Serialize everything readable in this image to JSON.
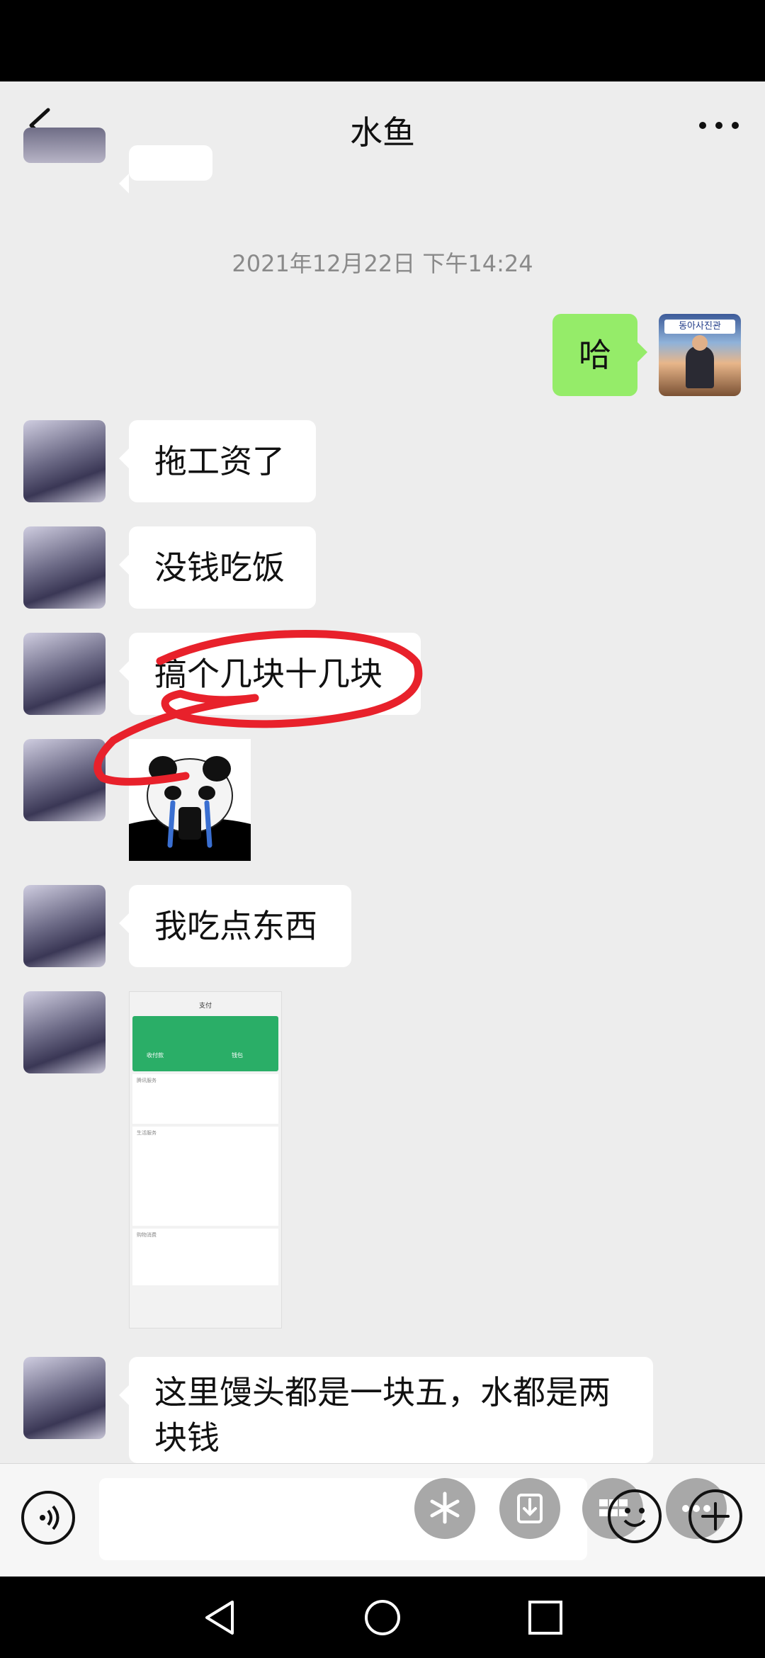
{
  "header": {
    "title": "水鱼"
  },
  "chat": {
    "timestamp": "2021年12月22日 下午14:24",
    "messages": [
      {
        "side": "right",
        "text": "哈"
      },
      {
        "side": "left",
        "text": "拖工资了"
      },
      {
        "side": "left",
        "text": "没钱吃饭"
      },
      {
        "side": "left",
        "text": "搞个几块十几块"
      },
      {
        "side": "left",
        "type": "sticker",
        "description": "panda crying sticker"
      },
      {
        "side": "left",
        "text": "我吃点东西"
      },
      {
        "side": "left",
        "type": "image"
      },
      {
        "side": "left",
        "text": "这里馒头都是一块五，水都是两块钱"
      }
    ],
    "sticker_text": "동아사진관",
    "mini_screenshot": {
      "header": "支付",
      "green_items": [
        "收付款",
        "钱包"
      ],
      "section_titles": [
        "腾讯服务",
        "生活服务",
        "购物消费"
      ]
    }
  },
  "colors": {
    "background": "#ededed",
    "bubble_self": "#95ec69",
    "bubble_other": "#ffffff",
    "annotation": "#e8212b"
  },
  "icons": {
    "back": "chevron-left-icon",
    "more": "ellipsis-icon",
    "voice": "voice-icon",
    "emoji": "emoji-icon",
    "plus": "plus-icon"
  }
}
